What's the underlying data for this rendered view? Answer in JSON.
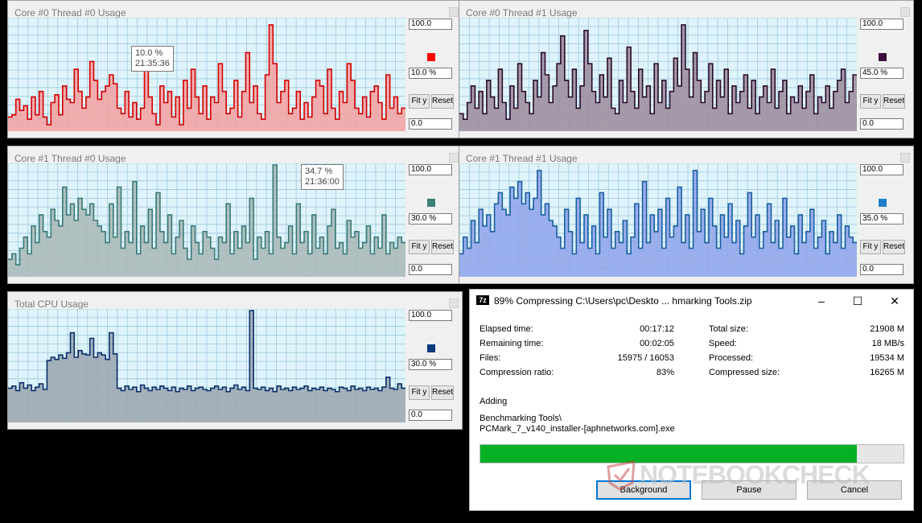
{
  "panels": [
    {
      "title": "Core #0 Thread #0 Usage",
      "max": "100.0",
      "cur": "10.0 %",
      "min": "0.0",
      "fit": "Fit y",
      "reset": "Reset",
      "line": "#d40000",
      "fill": "#f4a0a0",
      "swatch": "#ff0000",
      "tip": {
        "value": "10.0 %",
        "time": "21:35:36"
      },
      "series": [
        12,
        14,
        28,
        18,
        22,
        10,
        30,
        14,
        35,
        12,
        5,
        25,
        32,
        14,
        40,
        28,
        25,
        55,
        35,
        20,
        30,
        62,
        45,
        28,
        35,
        40,
        50,
        42,
        20,
        15,
        35,
        12,
        25,
        10,
        20,
        65,
        30,
        15,
        5,
        40,
        25,
        35,
        12,
        30,
        5,
        45,
        20,
        55,
        30,
        15,
        40,
        10,
        30,
        25,
        60,
        35,
        15,
        20,
        45,
        12,
        35,
        70,
        25,
        40,
        15,
        10,
        50,
        95,
        60,
        25,
        35,
        45,
        15,
        20,
        35,
        10,
        25,
        12,
        30,
        45,
        40,
        15,
        55,
        20,
        10,
        35,
        25,
        60,
        45,
        20,
        15,
        30,
        12,
        35,
        40,
        25,
        10,
        50,
        20,
        30,
        15,
        20
      ]
    },
    {
      "title": "Core #0 Thread #1 Usage",
      "max": "100.0",
      "cur": "45.0 %",
      "min": "0.0",
      "fit": "Fit y",
      "reset": "Reset",
      "line": "#2a0a2a",
      "fill": "#9b8a9a",
      "swatch": "#3b0e3b",
      "tip": null,
      "series": [
        15,
        10,
        25,
        40,
        20,
        35,
        15,
        45,
        30,
        20,
        55,
        25,
        10,
        40,
        20,
        60,
        35,
        25,
        15,
        45,
        30,
        70,
        50,
        25,
        40,
        60,
        85,
        45,
        30,
        55,
        20,
        40,
        90,
        60,
        35,
        25,
        50,
        30,
        65,
        20,
        15,
        45,
        25,
        75,
        35,
        20,
        55,
        30,
        40,
        15,
        60,
        25,
        45,
        20,
        35,
        65,
        40,
        95,
        55,
        30,
        70,
        45,
        25,
        35,
        60,
        20,
        45,
        30,
        55,
        15,
        40,
        25,
        35,
        50,
        20,
        45,
        15,
        30,
        40,
        25,
        55,
        20,
        35,
        45,
        15,
        30,
        25,
        40,
        20,
        35,
        50,
        15,
        30,
        25,
        40,
        20,
        35,
        45,
        55,
        25,
        35,
        50
      ]
    },
    {
      "title": "Core #1 Thread #0 Usage",
      "max": "100.0",
      "cur": "30.0 %",
      "min": "0.0",
      "fit": "Fit y",
      "reset": "Reset",
      "line": "#3a7a76",
      "fill": "#a9b7b6",
      "swatch": "#3b7f7a",
      "tip": {
        "value": "34.7 %",
        "time": "21:36:00"
      },
      "series": [
        15,
        20,
        10,
        25,
        35,
        20,
        45,
        30,
        55,
        40,
        35,
        60,
        50,
        45,
        80,
        55,
        65,
        50,
        70,
        60,
        55,
        65,
        50,
        45,
        40,
        30,
        65,
        35,
        80,
        25,
        40,
        30,
        85,
        20,
        45,
        30,
        60,
        25,
        75,
        40,
        30,
        55,
        20,
        35,
        50,
        25,
        15,
        45,
        30,
        20,
        40,
        35,
        25,
        15,
        35,
        30,
        65,
        20,
        40,
        25,
        45,
        30,
        70,
        15,
        35,
        25,
        40,
        20,
        100,
        35,
        25,
        30,
        45,
        20,
        65,
        30,
        40,
        20,
        55,
        25,
        35,
        20,
        45,
        60,
        25,
        30,
        20,
        50,
        35,
        40,
        25,
        30,
        45,
        20,
        35,
        25,
        55,
        20,
        30,
        25,
        35,
        30
      ]
    },
    {
      "title": "Core #1 Thread #1 Usage",
      "max": "100.0",
      "cur": "35.0 %",
      "min": "0.0",
      "fit": "Fit y",
      "reset": "Reset",
      "line": "#1a5fa0",
      "fill": "#8fa2ea",
      "swatch": "#1e7fc9",
      "tip": null,
      "series": [
        20,
        35,
        25,
        50,
        30,
        60,
        45,
        55,
        40,
        65,
        75,
        60,
        55,
        80,
        70,
        85,
        65,
        75,
        60,
        70,
        95,
        55,
        65,
        50,
        45,
        35,
        25,
        60,
        40,
        20,
        70,
        30,
        55,
        25,
        45,
        20,
        75,
        35,
        60,
        25,
        40,
        30,
        50,
        20,
        35,
        65,
        25,
        85,
        30,
        55,
        40,
        60,
        25,
        70,
        35,
        45,
        80,
        30,
        55,
        25,
        95,
        40,
        60,
        30,
        70,
        45,
        25,
        55,
        35,
        65,
        30,
        50,
        20,
        45,
        75,
        35,
        55,
        25,
        40,
        65,
        30,
        50,
        25,
        70,
        35,
        45,
        20,
        55,
        30,
        40,
        60,
        25,
        35,
        50,
        20,
        40,
        30,
        55,
        25,
        45,
        35,
        30
      ]
    },
    {
      "title": "Total CPU Usage",
      "max": "100.0",
      "cur": "30.0 %",
      "min": "0.0",
      "fit": "Fit y",
      "reset": "Reset",
      "line": "#0b2f6b",
      "fill": "#9aa5ae",
      "swatch": "#0a3a7a",
      "tip": null,
      "series": [
        30,
        32,
        28,
        35,
        30,
        33,
        28,
        31,
        34,
        29,
        55,
        58,
        56,
        60,
        57,
        62,
        80,
        58,
        64,
        61,
        60,
        75,
        58,
        62,
        60,
        56,
        80,
        61,
        30,
        28,
        32,
        29,
        31,
        27,
        33,
        30,
        28,
        31,
        29,
        32,
        30,
        28,
        31,
        27,
        30,
        29,
        32,
        28,
        30,
        31,
        29,
        28,
        30,
        32,
        29,
        31,
        27,
        30,
        33,
        29,
        31,
        28,
        100,
        30,
        29,
        31,
        28,
        30,
        27,
        32,
        29,
        30,
        28,
        31,
        29,
        30,
        32,
        28,
        30,
        29,
        31,
        28,
        30,
        29,
        27,
        31,
        30,
        28,
        32,
        29,
        30,
        28,
        31,
        29,
        30,
        28,
        31,
        40,
        30,
        29,
        34,
        30
      ]
    }
  ],
  "zip": {
    "title": "89% Compressing C:\\Users\\pc\\Deskto ... hmarking Tools.zip",
    "logo": "7z",
    "min_icon": "–",
    "max_icon": "☐",
    "close_icon": "✕",
    "left_rows": [
      {
        "label": "Elapsed time:",
        "value": "00:17:12"
      },
      {
        "label": "Remaining time:",
        "value": "00:02:05"
      },
      {
        "label": "Files:",
        "value": "15975 / 16053"
      },
      {
        "label": "Compression ratio:",
        "value": "83%"
      }
    ],
    "right_rows": [
      {
        "label": "Total size:",
        "value": "21908 M"
      },
      {
        "label": "Speed:",
        "value": "18 MB/s"
      },
      {
        "label": "Processed:",
        "value": "19534 M"
      },
      {
        "label": "Compressed size:",
        "value": "16265 M"
      }
    ],
    "adding_label": "Adding",
    "path_line1": "Benchmarking Tools\\",
    "path_line2": "PCMark_7_v140_installer-[aphnetworks.com].exe",
    "progress": 0.89,
    "buttons": {
      "background": "Background",
      "pause": "Pause",
      "cancel": "Cancel"
    }
  },
  "watermark": "NOTEBOOKCHECK"
}
